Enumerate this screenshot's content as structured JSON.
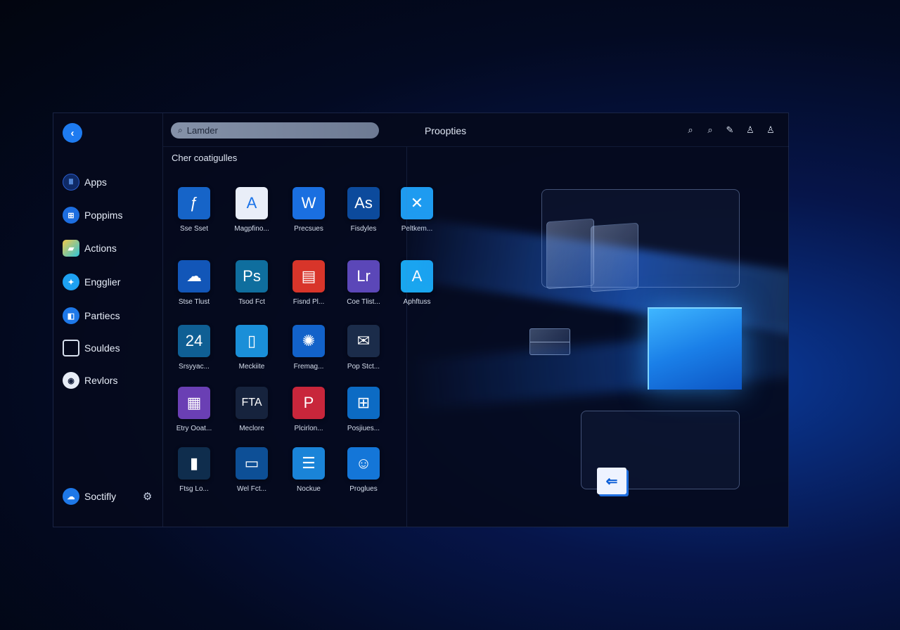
{
  "sidebar": {
    "items": [
      {
        "label": "Apps",
        "icon": "grid-icon"
      },
      {
        "label": "Poppims",
        "icon": "windows-icon"
      },
      {
        "label": "Actions",
        "icon": "folder-icon"
      },
      {
        "label": "Engglier",
        "icon": "bird-icon"
      },
      {
        "label": "Partiecs",
        "icon": "users-icon"
      },
      {
        "label": "Souldes",
        "icon": "monitor-icon"
      },
      {
        "label": "Revlors",
        "icon": "user-icon"
      }
    ],
    "footer_label": "Soctifly"
  },
  "search": {
    "placeholder": "Lamder"
  },
  "section_title": "Cher coatigulles",
  "apps": [
    {
      "label": "Sse Sset",
      "glyph": "ƒ",
      "color": "#1664c8"
    },
    {
      "label": "Magpfino...",
      "glyph": "A",
      "color": "#e9eef8"
    },
    {
      "label": "Precsues",
      "glyph": "W",
      "color": "#1a6fe0"
    },
    {
      "label": "Fisdyles",
      "glyph": "As",
      "color": "#0c4a9c"
    },
    {
      "label": "Peltkem...",
      "glyph": "✕",
      "color": "#1e9bf0"
    },
    {
      "label": "Stse Tlust",
      "glyph": "☁",
      "color": "#1256b8"
    },
    {
      "label": "Tsod Fct",
      "glyph": "Ps",
      "color": "#0f6e9e"
    },
    {
      "label": "Fisnd Pl...",
      "glyph": "▤",
      "color": "#d8352a"
    },
    {
      "label": "Coe Tlist...",
      "glyph": "Lr",
      "color": "#5b47b8"
    },
    {
      "label": "Aphftuss",
      "glyph": "A",
      "color": "#19a6ef"
    },
    {
      "label": "Srsyyac...",
      "glyph": "24",
      "color": "#0f5f94"
    },
    {
      "label": "Meckiite",
      "glyph": "▯",
      "color": "#1a8fd8"
    },
    {
      "label": "Fremag...",
      "glyph": "✺",
      "color": "#1262c9"
    },
    {
      "label": "Pop Stct...",
      "glyph": "✉",
      "color": "#1b2c4a"
    },
    {
      "label": "Etry Ooat...",
      "glyph": "▦",
      "color": "#6a3fb4"
    },
    {
      "label": "Meclore",
      "glyph": "FTA",
      "color": "#16233d"
    },
    {
      "label": "Plcirlon...",
      "glyph": "P",
      "color": "#c8263b"
    },
    {
      "label": "Posjiues...",
      "glyph": "⊞",
      "color": "#0c6bc4"
    },
    {
      "label": "Ftsg Lo...",
      "glyph": "▮",
      "color": "#0f2d4d"
    },
    {
      "label": "Wel Fct...",
      "glyph": "▭",
      "color": "#0d4f96"
    },
    {
      "label": "Nockue",
      "glyph": "☰",
      "color": "#1a84d8"
    },
    {
      "label": "Proglues",
      "glyph": "☺",
      "color": "#1476d8"
    }
  ],
  "header": {
    "title": "Proopties"
  },
  "header_icons": [
    "search-icon",
    "zoom-icon",
    "pen-icon",
    "person-icon",
    "account-icon"
  ]
}
